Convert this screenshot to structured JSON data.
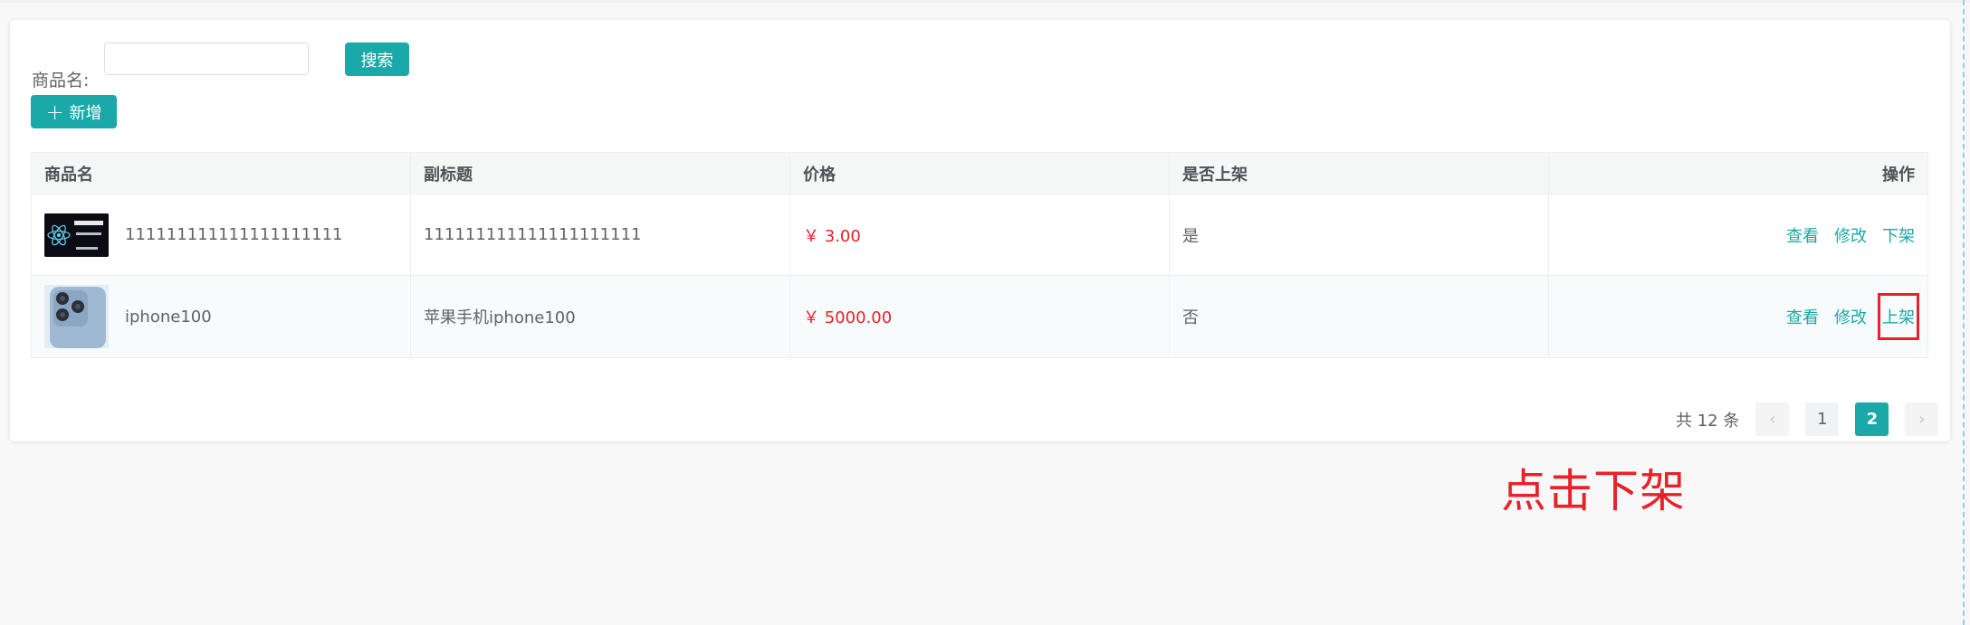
{
  "search": {
    "label": "商品名:",
    "value": "",
    "placeholder": "",
    "button": "搜索"
  },
  "toolbar": {
    "add_label": "新增",
    "add_icon": "plus-icon"
  },
  "table": {
    "headers": [
      "商品名",
      "副标题",
      "价格",
      "是否上架",
      "操作"
    ],
    "rows": [
      {
        "image_icon": "react-course-thumbnail",
        "name": "111111111111111111111",
        "subtitle": "111111111111111111111",
        "price": "￥ 3.00",
        "on_shelf": "是",
        "actions": [
          "查看",
          "修改",
          "下架"
        ]
      },
      {
        "image_icon": "iphone-thumbnail",
        "name": "iphone100",
        "subtitle": "苹果手机iphone100",
        "price": "￥ 5000.00",
        "on_shelf": "否",
        "actions": [
          "查看",
          "修改",
          "上架"
        ]
      }
    ]
  },
  "pagination": {
    "total": "共 12 条",
    "prev": "‹",
    "pages": [
      "1",
      "2"
    ],
    "current": "2",
    "next": "›"
  },
  "annotation": "点击下架",
  "colors": {
    "accent": "#1aa8a8",
    "price": "#e8222a",
    "annotation": "#e8222a"
  }
}
